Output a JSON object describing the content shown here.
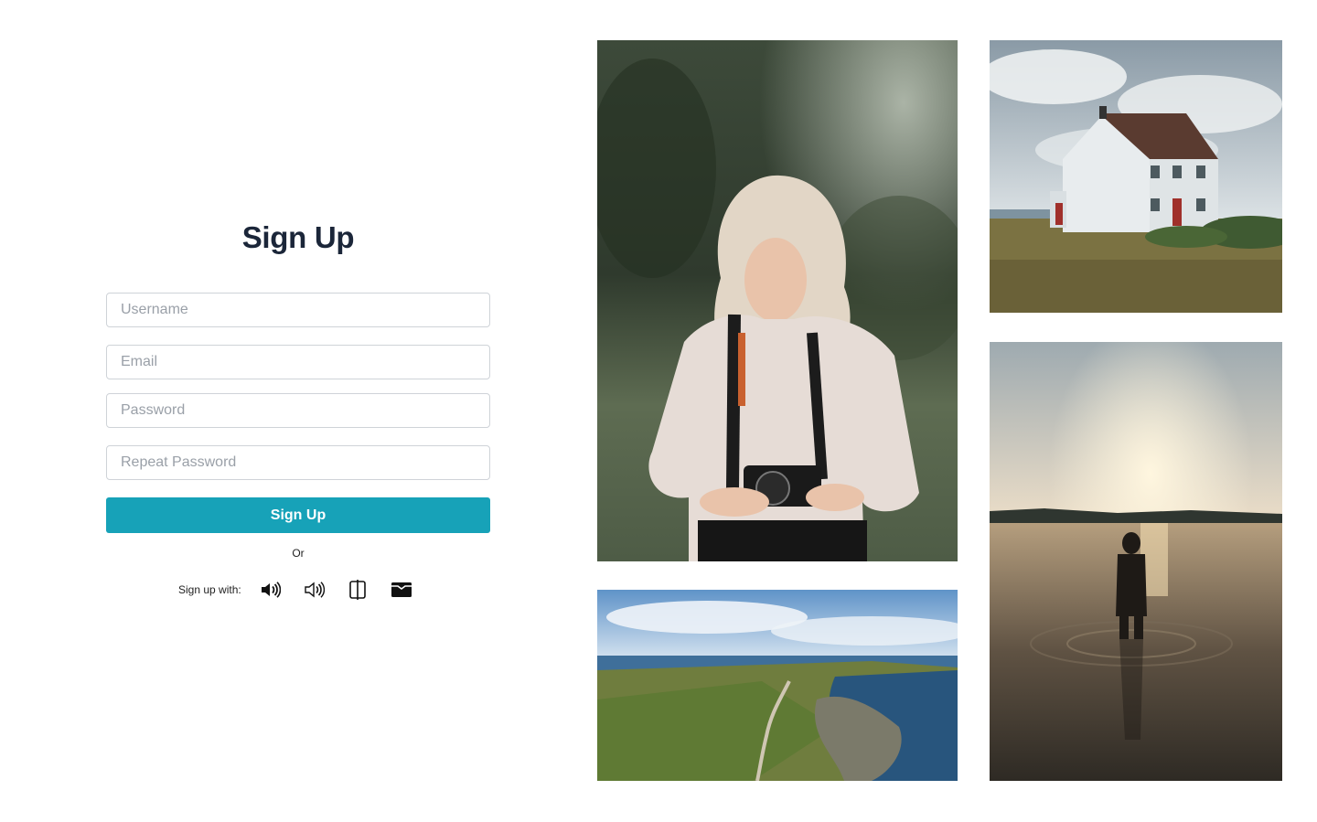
{
  "signup": {
    "title": "Sign Up",
    "fields": {
      "username_placeholder": "Username",
      "email_placeholder": "Email",
      "password_placeholder": "Password",
      "repeat_password_placeholder": "Repeat Password"
    },
    "submit_label": "Sign Up",
    "divider_text": "Or",
    "social_label": "Sign up with:",
    "social_icons": [
      "volume-loud-icon",
      "volume-icon",
      "columns-icon",
      "wallet-icon"
    ]
  },
  "colors": {
    "accent": "#17a2b8",
    "title": "#1b2639",
    "border": "#cfd3d8"
  },
  "gallery": {
    "images": [
      "woman-with-camera-photo",
      "white-house-photo",
      "coastline-aerial-photo",
      "sunset-lake-photo"
    ]
  }
}
